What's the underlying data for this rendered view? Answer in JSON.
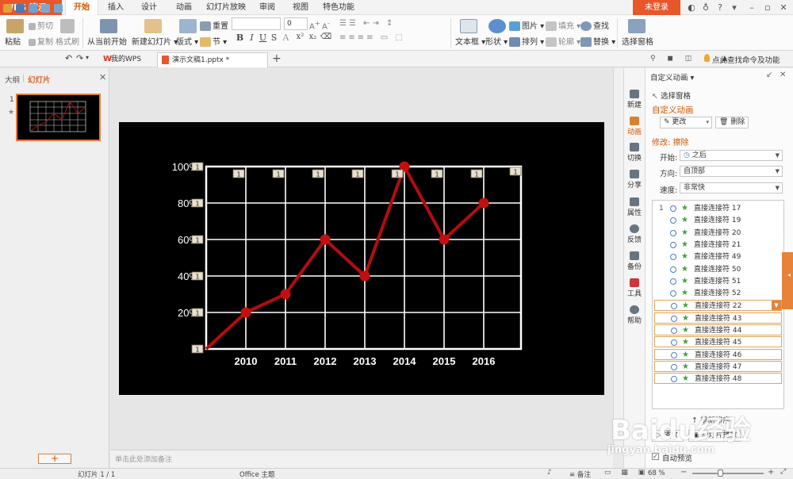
{
  "app": {
    "name": "WPS 演示"
  },
  "ribbon_tabs": [
    "开始",
    "插入",
    "设计",
    "动画",
    "幻灯片放映",
    "审阅",
    "视图",
    "特色功能"
  ],
  "login": "未登录",
  "ribbon": {
    "paste": "粘贴",
    "cut": "剪切",
    "copy": "复制",
    "format_painter": "格式刷",
    "from_current": "从当前开始",
    "new_slide": "新建幻灯片",
    "layout": "版式",
    "reset": "重置",
    "section": "节",
    "font_size": "0",
    "textbox": "文本框",
    "shape": "形状",
    "picture": "图片",
    "fill": "填充",
    "arrange": "排列",
    "outline": "轮廓",
    "find": "查找",
    "replace": "替换",
    "select_pane": "选择窗格"
  },
  "doc_tabs": [
    "我的WPS",
    "演示文稿1.pptx *"
  ],
  "search_hint": "点此查找命令及功能",
  "left_panel": {
    "tabs": [
      "大纲",
      "幻灯片"
    ],
    "slide_number": "1",
    "add_label": "+"
  },
  "notes_placeholder": "单击此处添加备注",
  "sidebar": [
    "新建",
    "动画",
    "切换",
    "分享",
    "属性",
    "反馈",
    "备份",
    "工具",
    "帮助"
  ],
  "pane": {
    "title": "自定义动画",
    "select_pane": "选择窗格",
    "heading": "自定义动画",
    "change_btn": "更改",
    "delete_btn": "删除",
    "modify": "修改: 擦除",
    "start_label": "开始:",
    "start_value": "之后",
    "direction_label": "方向:",
    "direction_value": "自顶部",
    "speed_label": "速度:",
    "speed_value": "非常快",
    "items": [
      {
        "num": "1",
        "name": "直接连接符 17"
      },
      {
        "num": "",
        "name": "直接连接符 19"
      },
      {
        "num": "",
        "name": "直接连接符 20"
      },
      {
        "num": "",
        "name": "直接连接符 21"
      },
      {
        "num": "",
        "name": "直接连接符 49"
      },
      {
        "num": "",
        "name": "直接连接符 50"
      },
      {
        "num": "",
        "name": "直接连接符 51"
      },
      {
        "num": "",
        "name": "直接连接符 52"
      },
      {
        "num": "",
        "name": "直接连接符 22"
      },
      {
        "num": "",
        "name": "直接连接符 43"
      },
      {
        "num": "",
        "name": "直接连接符 44"
      },
      {
        "num": "",
        "name": "直接连接符 45"
      },
      {
        "num": "",
        "name": "直接连接符 46"
      },
      {
        "num": "",
        "name": "直接连接符 47"
      },
      {
        "num": "",
        "name": "直接连接符 48"
      }
    ],
    "reorder": "重新排序",
    "play": "播放",
    "slideshow": "幻灯片播放",
    "autopreview": "自动预览"
  },
  "status": {
    "slide": "幻灯片 1 / 1",
    "theme": "Office 主题",
    "notes": "备注",
    "zoom": "68 %"
  },
  "chart_data": {
    "type": "line",
    "categories": [
      "2010",
      "2011",
      "2012",
      "2013",
      "2014",
      "2015",
      "2016"
    ],
    "series": [
      {
        "values": [
          0.2,
          0.3,
          0.6,
          0.4,
          1.0,
          0.6,
          0.8
        ]
      }
    ],
    "start_value": 0,
    "y_ticks": [
      "0",
      "20%",
      "40%",
      "60%",
      "80%",
      "100%"
    ],
    "ylim": [
      0,
      1
    ],
    "grid": true,
    "anim_tag": "1",
    "colors": {
      "line": "#b30d0d",
      "marker": "#c40f0f",
      "grid": "#ffffff",
      "background": "#000000"
    }
  },
  "watermark": {
    "brand": "Baidu经验",
    "url": "jingyan.baidu.com"
  }
}
